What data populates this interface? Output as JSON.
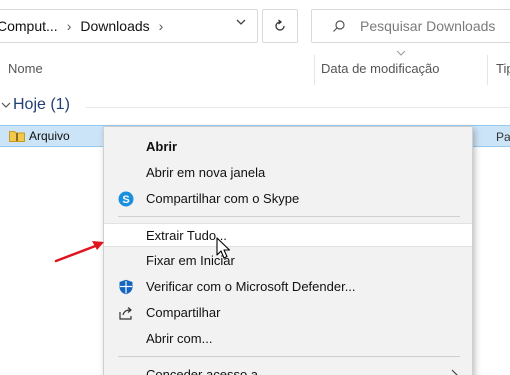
{
  "address_bar": {
    "crumbs": [
      "Comput...",
      "Downloads"
    ],
    "chevron_icon": "chevron-down-icon",
    "refresh_icon": "refresh-icon"
  },
  "search": {
    "placeholder": "Pesquisar Downloads",
    "icon": "search-icon"
  },
  "columns": {
    "name": "Nome",
    "date_modified": "Data de modificação",
    "type": "Tip"
  },
  "group": {
    "title": "Hoje (1)"
  },
  "file": {
    "name": "Arquivo",
    "type": "Pa",
    "icon": "zip-folder-icon"
  },
  "context_menu": {
    "items": [
      {
        "label": "Abrir",
        "bold": true
      },
      {
        "label": "Abrir em nova janela"
      },
      {
        "label": "Compartilhar com o Skype",
        "icon": "skype-icon"
      },
      {
        "label": "Extrair Tudo...",
        "hovered": true
      },
      {
        "label": "Fixar em Iniciar"
      },
      {
        "label": "Verificar com o Microsoft Defender...",
        "icon": "defender-icon"
      },
      {
        "label": "Compartilhar",
        "icon": "share-icon"
      },
      {
        "label": "Abrir com..."
      },
      {
        "label": "Conceder acesso a"
      }
    ]
  },
  "colors": {
    "selection_bg": "#cce4f7",
    "group_title": "#1f3f76",
    "annotation_arrow": "#e0141e",
    "skype": "#1a8fe0",
    "defender": "#1565c0"
  }
}
